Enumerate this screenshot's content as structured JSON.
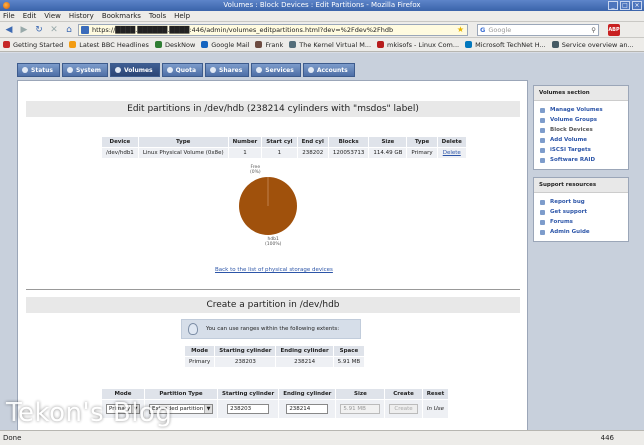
{
  "window": {
    "title": "Volumes : Block Devices : Edit Partitions - Mozilla Firefox"
  },
  "menu": [
    "File",
    "Edit",
    "View",
    "History",
    "Bookmarks",
    "Tools",
    "Help"
  ],
  "nav": {
    "url": "https://████.██████.████:446/admin/volumes_editpartitions.html?dev=%2Fdev%2Fhdb",
    "search_placeholder": "Google"
  },
  "bookmarks": [
    {
      "label": "Getting Started",
      "color": "#c62828"
    },
    {
      "label": "Latest BBC Headlines",
      "color": "#f39c12"
    },
    {
      "label": "DeskNow",
      "color": "#2e7d32"
    },
    {
      "label": "Google Mail",
      "color": "#1565c0"
    },
    {
      "label": "Frank",
      "color": "#6d4c41"
    },
    {
      "label": "The Kernel Virtual M...",
      "color": "#546e7a"
    },
    {
      "label": "mkisofs - Linux Com...",
      "color": "#b71c1c"
    },
    {
      "label": "Microsoft TechNet H...",
      "color": "#0277bd"
    },
    {
      "label": "Service overview an...",
      "color": "#455a64"
    }
  ],
  "tabs": [
    "Status",
    "System",
    "Volumes",
    "Quota",
    "Shares",
    "Services",
    "Accounts"
  ],
  "active_tab": "Volumes",
  "edit": {
    "title": "Edit partitions in /dev/hdb (238214 cylinders with \"msdos\" label)",
    "columns": [
      "Device",
      "Type",
      "Number",
      "Start cyl",
      "End cyl",
      "Blocks",
      "Size",
      "Type",
      "Delete"
    ],
    "rows": [
      [
        "/dev/hdb1",
        "Linux Physical Volume (0x8e)",
        "1",
        "1",
        "238202",
        "120053713",
        "114.49 GB",
        "Primary",
        "Delete"
      ]
    ],
    "pie_free_label": "Free",
    "pie_free_pct": "(0%)",
    "pie_used_label": "hdb1",
    "pie_used_pct": "(100%)",
    "back_link": "Back to the list of physical storage devices"
  },
  "create": {
    "title": "Create a partition in /dev/hdb",
    "info": "You can use ranges within the following extents:",
    "ext_columns": [
      "Mode",
      "Starting cylinder",
      "Ending cylinder",
      "Space"
    ],
    "ext_rows": [
      [
        "Primary",
        "238203",
        "238214",
        "5.91 MB"
      ]
    ],
    "form_columns": [
      "Mode",
      "Partition Type",
      "Starting cylinder",
      "Ending cylinder",
      "Size",
      "Create",
      "Reset"
    ],
    "form": {
      "mode": "Primary",
      "ptype": "Extended partition",
      "start": "238203",
      "end": "238214",
      "size": "5.91 MB",
      "create": "Create",
      "reset": "In Use"
    }
  },
  "volumes_section": {
    "title": "Volumes section",
    "items": [
      "Manage Volumes",
      "Volume Groups",
      "Block Devices",
      "Add Volume",
      "iSCSI Targets",
      "Software RAID"
    ],
    "current": "Block Devices"
  },
  "support": {
    "title": "Support resources",
    "items": [
      "Report bug",
      "Get support",
      "Forums",
      "Admin Guide"
    ]
  },
  "status": {
    "left": "Done",
    "right": "446"
  },
  "watermark": "Tekon's Blog",
  "chart_data": {
    "type": "pie",
    "slices": [
      {
        "label": "hdb1",
        "percent": 100,
        "color": "#a0510c"
      },
      {
        "label": "Free",
        "percent": 0,
        "color": "#e5e5e5"
      }
    ]
  }
}
